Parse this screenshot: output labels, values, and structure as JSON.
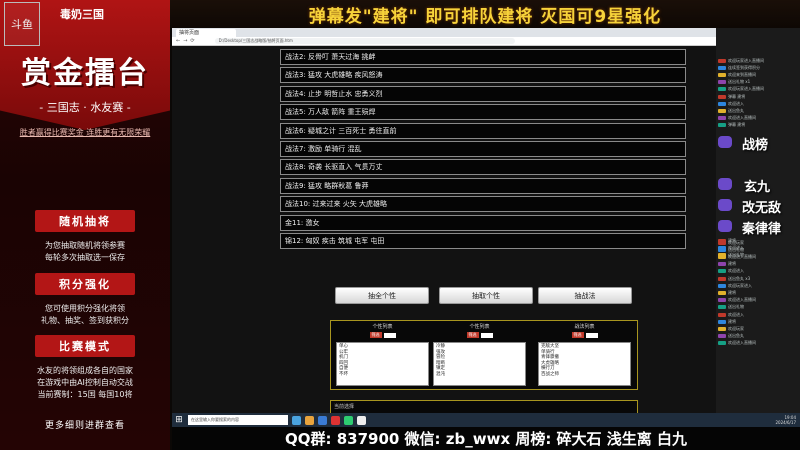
{
  "left_panel": {
    "logo_text": "斗鱼",
    "channel": "毒奶三国",
    "title": "赏金擂台",
    "subtitle": "- 三国志 · 水友赛 -",
    "tagline": "胜者赢得比赛奖金 连胜更有无限荣耀",
    "sections": [
      {
        "title": "随机抽将",
        "lines": [
          "为您抽取随机将领参赛",
          "每轮多次抽取选一保存"
        ]
      },
      {
        "title": "积分强化",
        "lines": [
          "您可使用积分强化将领",
          "礼物、抽奖、签到获积分"
        ]
      },
      {
        "title": "比赛模式",
        "lines": [
          "水友的将领组成各自的国家",
          "在游戏中由AI控制自动交战",
          "当前赛制：15国 每国10将"
        ]
      }
    ],
    "footer": "更多细则进群查看"
  },
  "top_banner": "弹幕发\"建将\" 即可排队建将 灭国可9星强化",
  "browser": {
    "tab_title": "抽将页面",
    "address": "D:/Desktop/三国志战略版/抽将页面.htm"
  },
  "strategies": [
    "战法2: 反骨叮 萧天过海 挑衅",
    "战法3: 猛攻 大虎雄略 疾风怒涛",
    "战法4: 止步 明哲止水 忠勇义烈",
    "战法5: 万人敌 箭阵 重王殒焊",
    "战法6: 疑城之计 三百死士 勇往直前",
    "战法7: 激励 单骑行 混乱",
    "战法8: 奇袭 长驱直入 气贯万丈",
    "战法9: 猛攻 略群秋葛 鲁莽",
    "战法10: 过来过来 火矢 大虎雄略",
    "金11: 激女",
    "锦12: 匈奴 疾击 筑城 屯军 屯田"
  ],
  "buttons": {
    "select_all": "抽全个性",
    "select_one": "抽取个性",
    "select_skill": "抽战法"
  },
  "columns": [
    {
      "title": "个性列表",
      "filter": "筛选",
      "items": [
        "单心",
        "公牢",
        "机门",
        "四回",
        "自便",
        "不坏"
      ]
    },
    {
      "title": "个性列表",
      "filter": "筛选",
      "items": [
        "冷静",
        "强攻",
        "冒险",
        "暗断",
        "镇定",
        "混沌"
      ]
    },
    {
      "title": "战法列表",
      "filter": "筛选",
      "items": [
        "克敌大坚",
        "单骑行",
        "青锋骤撤",
        "大虎雄略",
        "横行刀",
        "百战之师"
      ]
    }
  ],
  "message_label": "当前选择",
  "right_panel": {
    "rank_label": "战榜",
    "names": [
      "玄九",
      "改无敌",
      "秦律律"
    ],
    "chat": [
      "欢迎玩家进入直播间",
      "连续签到获得积分",
      "欢迎来到直播间",
      "送出礼物 x1",
      "欢迎玩家进入直播间",
      "弹幕 建将",
      "欢迎进入",
      "送出鱼丸",
      "欢迎进入直播间",
      "弹幕 建将",
      "欢迎玩家",
      "送出礼物",
      "欢迎进入直播间",
      "建将",
      "欢迎进入",
      "送出鱼丸 x3",
      "欢迎玩家进入",
      "建将",
      "欢迎进入直播间",
      "送出礼物",
      "欢迎进入",
      "建将",
      "欢迎玩家",
      "送出鱼丸",
      "欢迎进入直播间",
      "建将",
      "欢迎进入",
      "送出礼物"
    ]
  },
  "taskbar": {
    "search_placeholder": "在这里输入你要搜索的内容",
    "tray_time": "19:04",
    "tray_date": "2024/6/17"
  },
  "bottom_banner": "QQ群: 837900 微信: zb_wwx  周榜: 碎大石 浅生离 白九",
  "colors": {
    "accent_red": "#b31616",
    "banner_gold": "#f7d33a",
    "panel_border": "#a8951f"
  }
}
